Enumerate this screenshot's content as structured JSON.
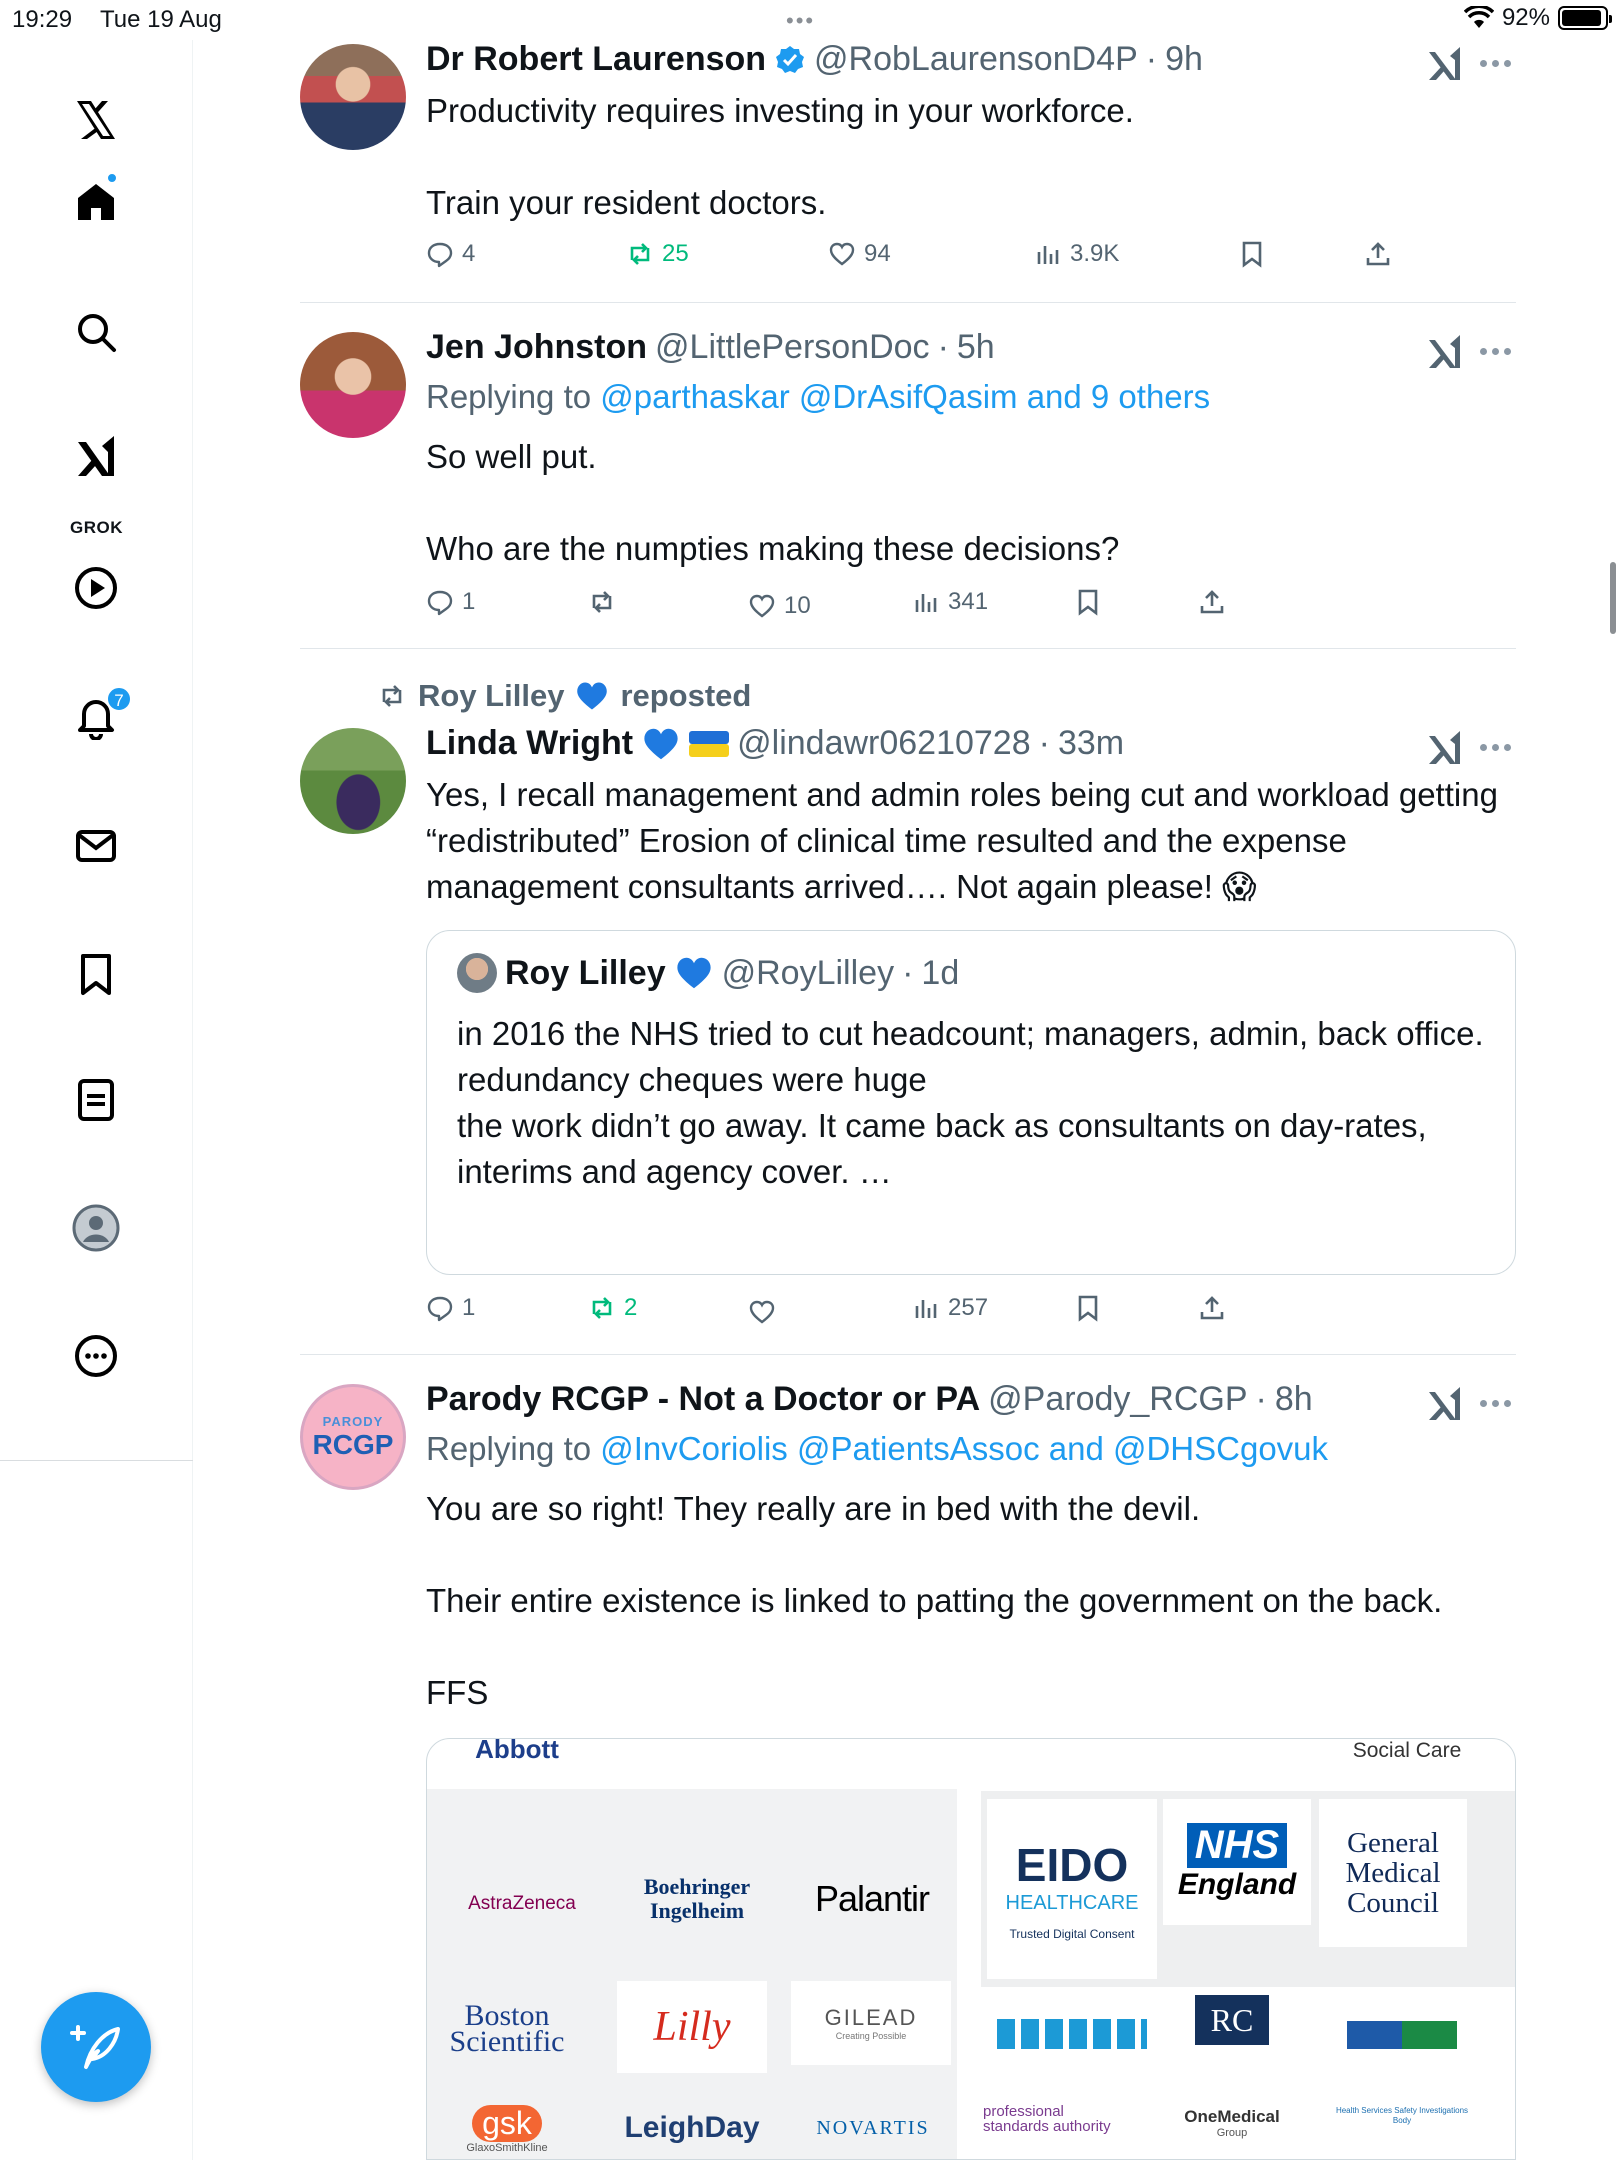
{
  "status_bar": {
    "time": "19:29",
    "date": "Tue 19 Aug",
    "battery": "92%",
    "battery_level": 0.92
  },
  "sidebar": {
    "grok_label": "GROK",
    "notifications_count": "7",
    "items": [
      "x-logo",
      "home",
      "search",
      "grok",
      "videos",
      "notifications",
      "messages",
      "bookmarks",
      "lists",
      "profile",
      "more"
    ]
  },
  "tweets": [
    {
      "name": "Dr Robert Laurenson",
      "verified": true,
      "handle": "@RobLaurensonD4P",
      "time": "9h",
      "body": "Productivity requires investing in your workforce.\n\nTrain your resident doctors.",
      "replies": "4",
      "reposts": "25",
      "likes": "94",
      "views": "3.9K"
    },
    {
      "name": "Jen Johnston",
      "handle": "@LittlePersonDoc",
      "time": "5h",
      "replying_prefix": "Replying to ",
      "replying_to": "@parthaskar @DrAsifQasim and 9 others",
      "body": "So well put.\n\nWho are the numpties making these decisions?",
      "replies": "1",
      "reposts": "",
      "likes": "10",
      "views": "341"
    },
    {
      "repost_by": "Roy Lilley",
      "repost_suffix": "reposted",
      "name": "Linda Wright",
      "handle": "@lindawr06210728",
      "time": "33m",
      "body": "Yes, I recall management and admin roles being cut and workload getting “redistributed” Erosion of clinical time resulted and the expense management consultants arrived…. Not again please! 😱",
      "quote": {
        "name": "Roy Lilley",
        "handle": "@RoyLilley",
        "time": "1d",
        "body": "in 2016 the NHS tried to cut headcount; managers, admin, back office.\nredundancy cheques were huge\nthe work didn’t go away. It came back as consultants on day-rates, interims and agency cover.  …"
      },
      "replies": "1",
      "reposts": "2",
      "likes": "",
      "views": "257"
    },
    {
      "name": "Parody RCGP - Not a Doctor or PA",
      "handle": "@Parody_RCGP",
      "time": "8h",
      "avatar_text_top": "PARODY",
      "avatar_text_main": "RCGP",
      "replying_prefix": "Replying to ",
      "replying_to": "@InvCoriolis @PatientsAssoc and @DHSCgovuk",
      "body": "You are so right! They really are in bed with the devil.\n\nTheir entire existence is linked to patting the government on the back.\n\nFFS",
      "media_logos": {
        "top_partial": [
          "Abbott",
          "Social Care"
        ],
        "astrazeneca": "AstraZeneca",
        "boehringer": "Boehringer Ingelheim",
        "palantir": "Palantir",
        "eido_main": "EIDO",
        "eido_sub": "HEALTHCARE",
        "eido_tag": "Trusted Digital Consent",
        "nhs": "NHS",
        "nhs_sub": "England",
        "gmc": "General Medical Council",
        "boston": "Boston Scientific",
        "lilly": "Lilly",
        "gilead": "GILEAD",
        "gilead_tag": "Creating Possible",
        "rc": "RC",
        "gsk": "gsk",
        "gsk_sub": "GlaxoSmithKline",
        "leighday": "LeighDay",
        "novartis": "NOVARTIS",
        "psa": "professional standards authority",
        "onemedical": "OneMedical",
        "onemedical_sub": "Group",
        "hssib": "Health Services Safety Investigations Body"
      }
    }
  ],
  "colors": {
    "accent": "#1d9bf0",
    "repost_green": "#00ba7c",
    "secondary_text": "#536471"
  }
}
